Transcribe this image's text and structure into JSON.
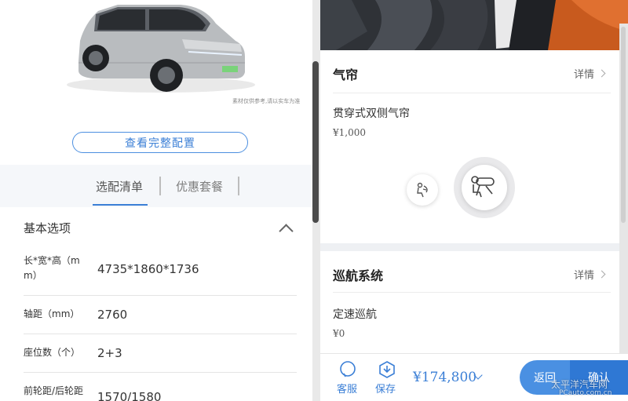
{
  "left": {
    "disclaimer": "素材仅供参考,请以实车为准",
    "full_config_button": "查看完整配置",
    "tabs": [
      {
        "label": "选配清单",
        "active": true
      },
      {
        "label": "优惠套餐",
        "active": false
      }
    ],
    "section_title": "基本选项",
    "specs": [
      {
        "label_line1": "长*宽*高（m",
        "label_line2": "m）",
        "value": "4735*1860*1736"
      },
      {
        "label": "轴距（mm）",
        "value": "2760"
      },
      {
        "label": "座位数（个）",
        "value": "2+3"
      },
      {
        "label": "前轮距/后轮距",
        "value": "1570/1580"
      }
    ]
  },
  "right": {
    "cards": [
      {
        "title": "气帘",
        "detail": "详情",
        "item": "贯穿式双侧气帘",
        "price": "¥1,000"
      },
      {
        "title": "巡航系统",
        "detail": "详情",
        "item": "定速巡航",
        "price": "¥0"
      }
    ],
    "bottom_bar": {
      "service_label": "客服",
      "save_label": "保存",
      "total_price": "¥174,800",
      "back_label": "返回",
      "confirm_label": "确认"
    }
  },
  "watermark": {
    "main": "太平洋汽车网",
    "sub": "PCauto.com.cn"
  },
  "colors": {
    "accent": "#3b7fd6",
    "button_dark": "#2f78d4",
    "button_light": "#4a90e2",
    "car_body": "#b9bcbf"
  },
  "icons": {
    "airbag_small": "airbag-passenger-icon",
    "airbag_large": "curtain-airbag-icon",
    "service": "customer-service-icon",
    "save": "save-download-icon"
  }
}
